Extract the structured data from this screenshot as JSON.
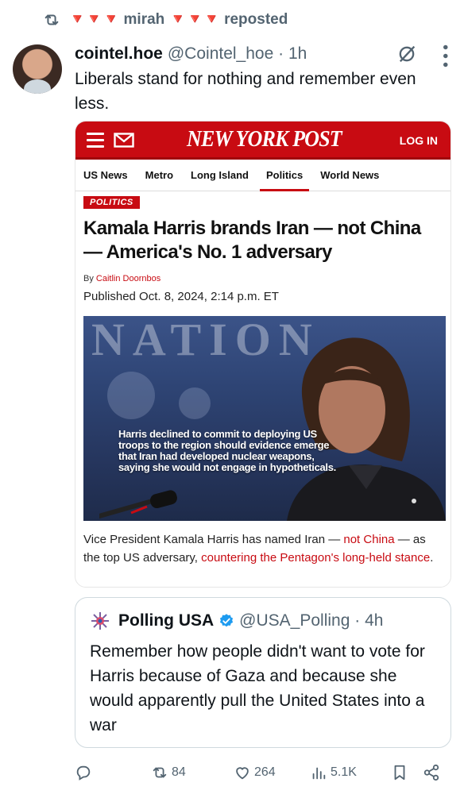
{
  "repost": {
    "hearts_before": "🔻🔻🔻",
    "user": "mirah",
    "hearts_after": "🔻🔻🔻",
    "label": "reposted"
  },
  "post": {
    "display_name": "cointel.hoe",
    "handle": "@Cointel_hoe",
    "separator": "·",
    "time": "1h",
    "text": "Liberals stand for nothing and remember even less."
  },
  "article": {
    "brand": "NEW YORK POST",
    "login": "LOG IN",
    "nav": [
      "US News",
      "Metro",
      "Long Island",
      "Politics",
      "World News"
    ],
    "active_nav_index": 3,
    "section": "POLITICS",
    "headline": "Kamala Harris brands Iran — not China — America's No. 1 adversary",
    "byline_prefix": "By",
    "author": "Caitlin Doornbos",
    "published": "Published Oct. 8, 2024, 2:14 p.m. ET",
    "photo_banner": "NATION",
    "photo_caption": "Harris declined to commit to deploying US troops to the region should evidence emerge that Iran had developed nuclear weapons, saying she would not engage in hypotheticals.",
    "lede_1": "Vice President Kamala Harris has named Iran — ",
    "lede_link_1": "not China",
    "lede_2": " — as the top US adversary, ",
    "lede_link_2": "countering the Pentagon's long-held stance",
    "lede_3": "."
  },
  "quote": {
    "display_name": "Polling USA",
    "handle": "@USA_Polling",
    "separator": "·",
    "time": "4h",
    "text": "Remember how people didn't want to vote for Harris because of Gaza and because she would apparently pull the United States into a war"
  },
  "actions": {
    "reposts": "84",
    "likes": "264",
    "views": "5.1K"
  },
  "colors": {
    "nyp_red": "#c80b12",
    "secondary_text": "#536471",
    "verified_blue": "#1d9bf0"
  }
}
